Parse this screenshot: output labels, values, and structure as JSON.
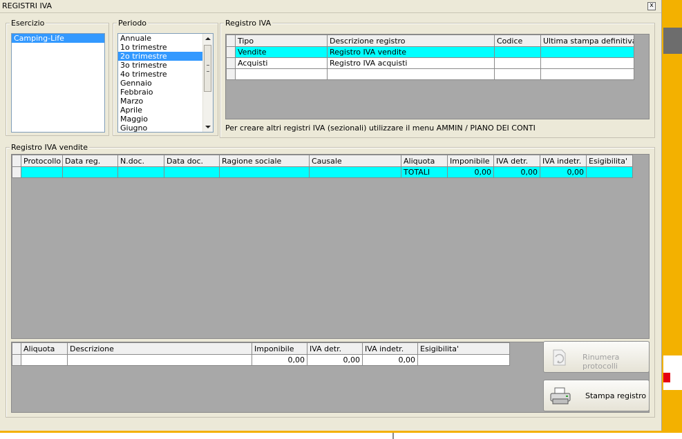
{
  "window": {
    "title": "REGISTRI IVA",
    "close_label": "x"
  },
  "esercizio": {
    "legend": "Esercizio",
    "items": [
      "Camping-Life"
    ],
    "selected": 0
  },
  "periodo": {
    "legend": "Periodo",
    "items": [
      "Annuale",
      "1o trimestre",
      "2o trimestre",
      "3o trimestre",
      "4o trimestre",
      "Gennaio",
      "Febbraio",
      "Marzo",
      "Aprile",
      "Maggio",
      "Giugno"
    ],
    "selected": 2
  },
  "registro_iva": {
    "legend": "Registro IVA",
    "columns": [
      "Tipo",
      "Descrizione registro",
      "Codice",
      "Ultima stampa definitiva"
    ],
    "rows": [
      [
        "Vendite",
        "Registro IVA vendite",
        "",
        ""
      ],
      [
        "Acquisti",
        "Registro IVA acquisti",
        "",
        ""
      ],
      [
        "",
        "",
        "",
        ""
      ]
    ],
    "note": "Per creare altri registri IVA (sezionali) utilizzare il menu AMMIN / PIANO DEI CONTI"
  },
  "vendite": {
    "legend": "Registro IVA vendite",
    "columns": [
      "Protocollo",
      "Data reg.",
      "N.doc.",
      "Data doc.",
      "Ragione sociale",
      "Causale",
      "Aliquota",
      "Imponibile",
      "IVA detr.",
      "IVA indetr.",
      "Esigibilita'"
    ],
    "totals_row": [
      "",
      "",
      "",
      "",
      "",
      "",
      "TOTALI",
      "0,00",
      "0,00",
      "0,00",
      ""
    ]
  },
  "riepilogo": {
    "columns": [
      "Aliquota",
      "Descrizione",
      "Imponibile",
      "IVA detr.",
      "IVA indetr.",
      "Esigibilita'"
    ],
    "row": [
      "",
      "",
      "0,00",
      "0,00",
      "0,00",
      ""
    ]
  },
  "buttons": {
    "rinumera": "Rinumera protocolli",
    "stampa": "Stampa registro"
  }
}
